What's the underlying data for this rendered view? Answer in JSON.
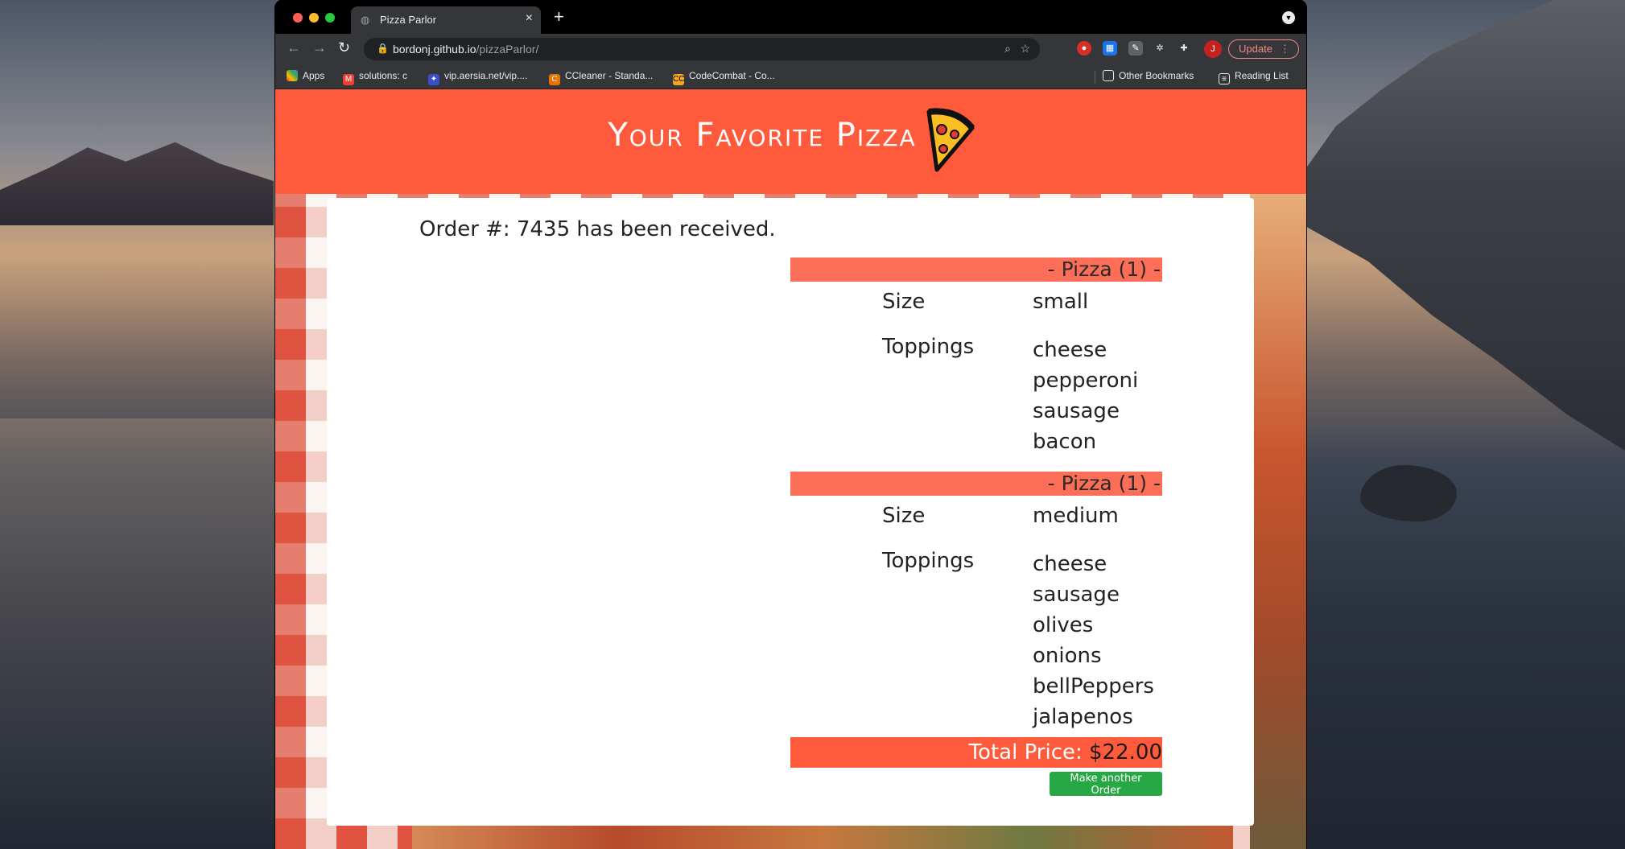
{
  "browser": {
    "tab_title": "Pizza Parlor",
    "url_host": "bordonj.github.io",
    "url_path": "/pizzaParlor/",
    "avatar_letter": "J",
    "update_label": "Update",
    "update_dots": "⋮",
    "bookmarks": [
      {
        "label": "Apps",
        "icon": "apps-grid-icon"
      },
      {
        "label": "solutions: c",
        "icon": "gmail-icon"
      },
      {
        "label": "vip.aersia.net/vip....",
        "icon": "aersia-icon"
      },
      {
        "label": "CCleaner - Standa...",
        "icon": "ccleaner-icon"
      },
      {
        "label": "CodeCombat - Co...",
        "icon": "codecombat-icon"
      },
      {
        "label": "Other Bookmarks",
        "icon": "folder-icon"
      },
      {
        "label": "Reading List",
        "icon": "reading-list-icon"
      }
    ]
  },
  "page": {
    "title": "Your Favorite Pizza",
    "order_message": "Order #: 7435 has been received.",
    "size_label": "Size",
    "toppings_label": "Toppings",
    "pizzas": [
      {
        "header": "- Pizza (1) -",
        "size": "small",
        "toppings": [
          "cheese",
          "pepperoni",
          "sausage",
          "bacon"
        ]
      },
      {
        "header": "- Pizza (1) -",
        "size": "medium",
        "toppings": [
          "cheese",
          "sausage",
          "olives",
          "onions",
          "bellPeppers",
          "jalapenos"
        ]
      }
    ],
    "total_label": "Total Price:",
    "total_amount": "$22.00",
    "again_button": "Make another Order"
  },
  "colors": {
    "header_red": "#ff5a3c",
    "pizza_header_salmon": "#fd6e58",
    "button_green": "#28a745"
  }
}
